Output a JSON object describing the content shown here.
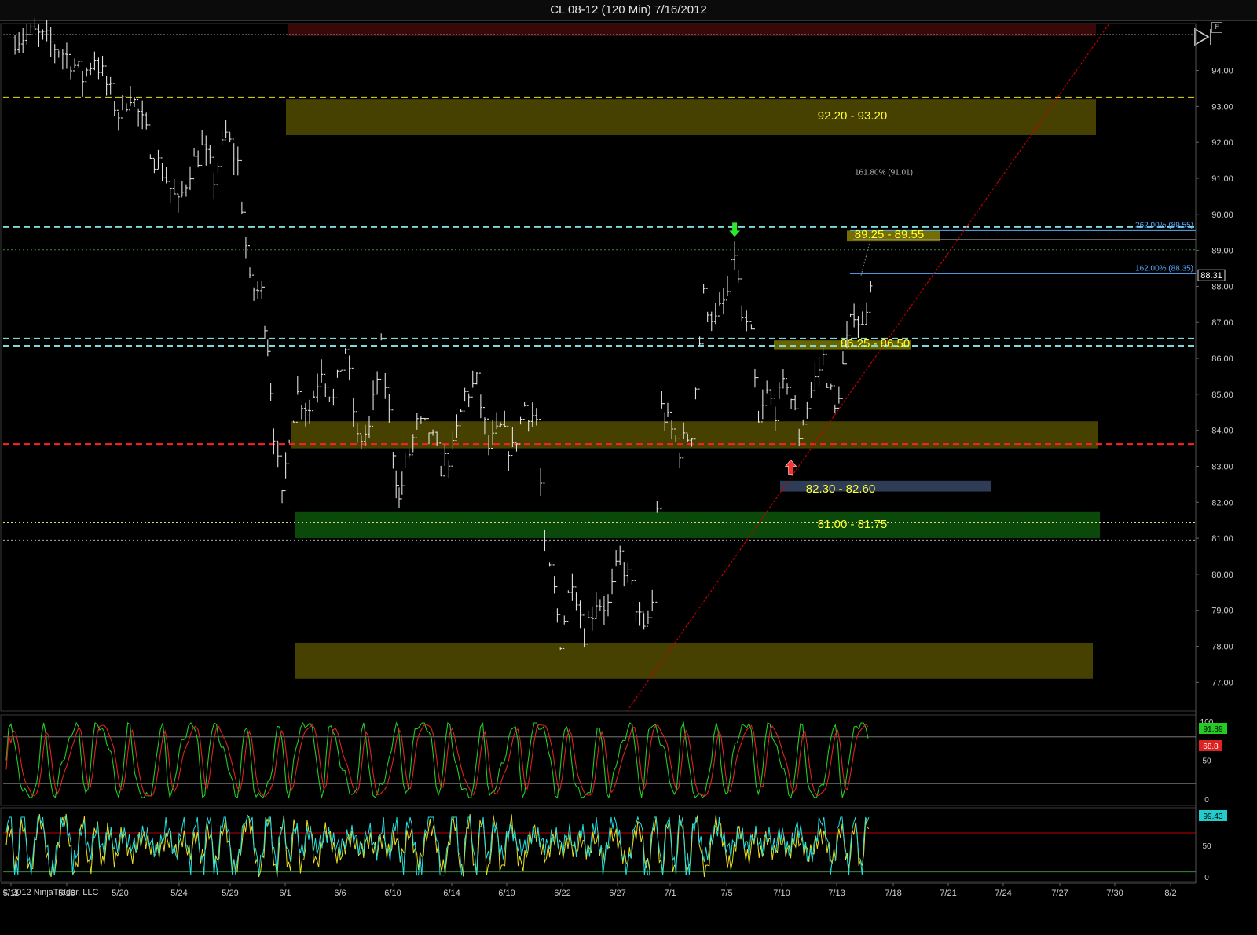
{
  "window": {
    "title": "CL 08-12 (120 Min)  7/16/2012",
    "frame_label": "F",
    "copyright": "© 2012 NinjaTrader, LLC"
  },
  "chart_data": [
    {
      "type": "candlestick",
      "panel": "price",
      "ylim": [
        76.2,
        95.3
      ],
      "y_ticks": [
        "94.00",
        "93.00",
        "92.00",
        "91.00",
        "90.00",
        "89.00",
        "88.00",
        "87.00",
        "86.00",
        "85.00",
        "84.00",
        "83.00",
        "82.00",
        "81.00",
        "80.00",
        "79.00",
        "78.00",
        "77.00"
      ],
      "x_ticks": [
        "5/11",
        "5/16",
        "5/20",
        "5/24",
        "5/29",
        "6/1",
        "6/6",
        "6/10",
        "6/14",
        "6/19",
        "6/22",
        "6/27",
        "7/1",
        "7/5",
        "7/10",
        "7/13",
        "7/18",
        "7/21",
        "7/24",
        "7/27",
        "7/30",
        "8/2"
      ],
      "last_price": "88.31",
      "price_path": [
        [
          0,
          94.9
        ],
        [
          2,
          95.0
        ],
        [
          4,
          94.6
        ],
        [
          5,
          94.3
        ],
        [
          6,
          93.8
        ],
        [
          7,
          94.4
        ],
        [
          8,
          93.6
        ],
        [
          9,
          92.8
        ],
        [
          10,
          93.4
        ],
        [
          11,
          92.5
        ],
        [
          12,
          91.6
        ],
        [
          13,
          91.0
        ],
        [
          14,
          90.2
        ],
        [
          15,
          91.3
        ],
        [
          16,
          91.8
        ],
        [
          17,
          91.0
        ],
        [
          18,
          92.2
        ],
        [
          19,
          91.4
        ],
        [
          20,
          88.0
        ],
        [
          21,
          87.8
        ],
        [
          21.5,
          86.4
        ],
        [
          22,
          84.0
        ],
        [
          22.7,
          82.0
        ],
        [
          23.3,
          84.0
        ],
        [
          24,
          85.0
        ],
        [
          25,
          84.6
        ],
        [
          26,
          85.8
        ],
        [
          27,
          84.8
        ],
        [
          28,
          86.3
        ],
        [
          29,
          83.7
        ],
        [
          30,
          84.0
        ],
        [
          31,
          86.2
        ],
        [
          32,
          83.5
        ],
        [
          32.5,
          82.0
        ],
        [
          33,
          83.0
        ],
        [
          34,
          84.1
        ],
        [
          35,
          84.0
        ],
        [
          36,
          83.0
        ],
        [
          37,
          83.4
        ],
        [
          38,
          85.0
        ],
        [
          39,
          85.3
        ],
        [
          40,
          83.5
        ],
        [
          41,
          84.0
        ],
        [
          42,
          83.4
        ],
        [
          43,
          84.7
        ],
        [
          44,
          84.3
        ],
        [
          44.7,
          80.6
        ],
        [
          45.5,
          79.5
        ],
        [
          46,
          78.2
        ],
        [
          47,
          80.0
        ],
        [
          48,
          78.4
        ],
        [
          49,
          79.3
        ],
        [
          50,
          79.1
        ],
        [
          51,
          80.5
        ],
        [
          52,
          79.6
        ],
        [
          53,
          78.3
        ],
        [
          53.7,
          79.2
        ],
        [
          54.5,
          84.6
        ],
        [
          55,
          84.2
        ],
        [
          56,
          83.5
        ],
        [
          57,
          84.0
        ],
        [
          58,
          87.7
        ],
        [
          59,
          87.0
        ],
        [
          60,
          87.8
        ],
        [
          60.6,
          89.0
        ],
        [
          61.2,
          87.1
        ],
        [
          62,
          86.5
        ],
        [
          62.6,
          84.1
        ],
        [
          63.3,
          85.0
        ],
        [
          64,
          84.6
        ],
        [
          65,
          85.4
        ],
        [
          66,
          83.9
        ],
        [
          67,
          85.1
        ],
        [
          68,
          86.0
        ],
        [
          69,
          84.5
        ],
        [
          70,
          86.4
        ],
        [
          70.6,
          87.4
        ],
        [
          71.3,
          86.8
        ],
        [
          72,
          88.3
        ]
      ],
      "price_range_bands": [
        {
          "label": "92.20 - 93.20",
          "low": 92.2,
          "high": 93.2,
          "color": "#4a4400"
        },
        {
          "label": "89.25 - 89.55",
          "low": 89.25,
          "high": 89.55,
          "color": "#7a7400"
        },
        {
          "label": "86.25 - 86.50",
          "low": 86.25,
          "high": 86.5,
          "color": "#6e6900"
        },
        {
          "label": "",
          "low": 83.5,
          "high": 84.25,
          "color": "#4a4400"
        },
        {
          "label": "82.30 - 82.60",
          "low": 82.3,
          "high": 82.6,
          "color": "#30405a"
        },
        {
          "label": "81.00 - 81.75",
          "low": 81.0,
          "high": 81.75,
          "color": "#0b4d0b"
        },
        {
          "label": "",
          "low": 77.1,
          "high": 78.1,
          "color": "#4a4400"
        },
        {
          "label": "",
          "low": 94.95,
          "high": 95.3,
          "color": "#3c0808"
        }
      ],
      "horizontal_lines": [
        {
          "price": 93.25,
          "color": "#e8e000",
          "style": "dashed"
        },
        {
          "price": 89.65,
          "color": "#7fd8d8",
          "style": "dashed"
        },
        {
          "price": 89.02,
          "color": "#3a8a3a",
          "style": "dotted"
        },
        {
          "price": 86.55,
          "color": "#7fd8d8",
          "style": "dashed"
        },
        {
          "price": 86.35,
          "color": "#7fd8d8",
          "style": "dashed"
        },
        {
          "price": 86.12,
          "color": "#b01010",
          "style": "dotted"
        },
        {
          "price": 83.62,
          "color": "#ff2020",
          "style": "dashed"
        },
        {
          "price": 81.45,
          "color": "#dddd88",
          "style": "dotted"
        },
        {
          "price": 80.95,
          "color": "#aaaaaa",
          "style": "dotted"
        }
      ],
      "fibonacci_labels": [
        {
          "text": "161.80% (91.01)",
          "price": 91.01,
          "color": "#bbbbbb"
        },
        {
          "text": "262.00% (89.55)",
          "price": 89.55,
          "color": "#55a8ff"
        },
        {
          "text": "162.00% (88.35)",
          "price": 88.35,
          "color": "#55a8ff"
        }
      ],
      "trendline": {
        "from": [
          50,
          76.3
        ],
        "to": [
          120,
          95.3
        ],
        "color": "#c00000"
      },
      "markers": [
        {
          "type": "down-arrow",
          "bar": 60.6,
          "price": 89.55,
          "color": "#2ee62e"
        },
        {
          "type": "up-arrow",
          "bar": 65.3,
          "price": 83.0,
          "color": "#ff3030"
        }
      ]
    },
    {
      "type": "line",
      "panel": "stochastics",
      "ylim": [
        0,
        100
      ],
      "y_ticks": [
        "100",
        "50",
        "0"
      ],
      "series": [
        {
          "name": "",
          "color": "#22cc22",
          "last": "91.89"
        },
        {
          "name": "",
          "color": "#dd2222",
          "last": "68.8"
        }
      ],
      "reference_lines": [
        80,
        20
      ]
    },
    {
      "type": "line",
      "panel": "oscillator",
      "ylim": [
        0,
        100
      ],
      "y_ticks": [
        "50",
        "0"
      ],
      "series": [
        {
          "name": "",
          "color": "#e8e020",
          "last": ""
        },
        {
          "name": "",
          "color": "#22e0e0",
          "last": "99.43"
        }
      ],
      "reference_lines": [
        70,
        8
      ]
    }
  ],
  "colors": {
    "background": "#000000",
    "bars": "#e0e0e0",
    "band_text": "#ffff33"
  }
}
